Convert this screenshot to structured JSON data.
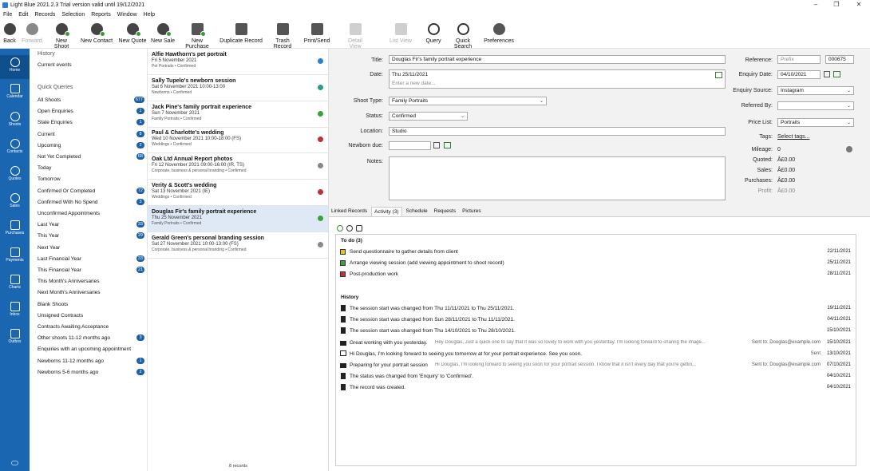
{
  "titlebar": {
    "title": "Light Blue 2021.2.3    Trial version valid until 19/12/2021"
  },
  "menu": [
    "File",
    "Edit",
    "Records",
    "Selection",
    "Reports",
    "Window",
    "Help"
  ],
  "toolbar": {
    "back": "Back",
    "forward": "Forward",
    "new_shoot": "New Shoot",
    "new_contact": "New Contact",
    "new_quote": "New Quote",
    "new_sale": "New Sale",
    "new_purchase": "New Purchase",
    "duplicate": "Duplicate Record",
    "trash": "Trash Record",
    "print": "Print/Send",
    "detail_view": "Detail View",
    "list_view": "List View",
    "query": "Query",
    "quick_search": "Quick Search",
    "preferences": "Preferences"
  },
  "sidebar": {
    "home": "Home",
    "calendar": "Calendar",
    "shoots": "Shoots",
    "contacts": "Contacts",
    "quotes": "Quotes",
    "sales": "Sales",
    "purchases": "Purchases",
    "payments": "Payments",
    "charts": "Charts",
    "inbox": "Inbox",
    "outbox": "Outbox"
  },
  "queries": {
    "history_label": "History",
    "current_events": "Current events",
    "quick_label": "Quick Queries",
    "items": [
      {
        "label": "All Shoots",
        "count": "677"
      },
      {
        "label": "Open Enquiries",
        "count": "1"
      },
      {
        "label": "Stale Enquiries",
        "count": "1"
      },
      {
        "label": "Current",
        "count": "8"
      },
      {
        "label": "Upcoming",
        "count": "2"
      },
      {
        "label": "Not Yet Completed",
        "count": "68"
      },
      {
        "label": "Today",
        "count": ""
      },
      {
        "label": "Tomorrow",
        "count": ""
      },
      {
        "label": "Confirmed Or Completed",
        "count": "72"
      },
      {
        "label": "Confirmed With No Spend",
        "count": "3"
      },
      {
        "label": "Unconfirmed Appointments",
        "count": ""
      },
      {
        "label": "Last Year",
        "count": "33"
      },
      {
        "label": "This Year",
        "count": "29"
      },
      {
        "label": "Next Year",
        "count": ""
      },
      {
        "label": "Last Financial Year",
        "count": "33"
      },
      {
        "label": "This Financial Year",
        "count": "21"
      },
      {
        "label": "This Month's Anniversaries",
        "count": ""
      },
      {
        "label": "Next Month's Anniversaries",
        "count": ""
      },
      {
        "label": "Blank Shoots",
        "count": ""
      },
      {
        "label": "Unsigned Contracts",
        "count": ""
      },
      {
        "label": "Contracts Awaiting Acceptance",
        "count": ""
      },
      {
        "label": "Other shoots 11-12 months ago",
        "count": "3"
      },
      {
        "label": "Enquiries with an upcoming appointment",
        "count": ""
      },
      {
        "label": "Newborns 11-12 months ago",
        "count": "1"
      },
      {
        "label": "Newborns 5-6 months ago",
        "count": "2"
      }
    ]
  },
  "records": [
    {
      "title": "Alfie Hawthorn's pet portrait",
      "date": "Fri 5 November 2021",
      "sub": "Pet Portraits  •  Confirmed",
      "color": "#2a7fd4"
    },
    {
      "title": "Sally Tupelo's newborn session",
      "date": "Sat 6 November 2021 10:00-13:00",
      "sub": "Newborns  •  Confirmed",
      "color": "#2a9a8a"
    },
    {
      "title": "Jack Pine's family portrait experience",
      "date": "Sun 7 November 2021",
      "sub": "Family Portraits  •  Confirmed",
      "color": "#3aa040"
    },
    {
      "title": "Paul & Charlotte's wedding",
      "date": "Wed 10 November 2021 10:00-18:00 (FS)",
      "sub": "Weddings  •  Confirmed",
      "color": "#c0303a"
    },
    {
      "title": "Oak Ltd Annual Report photos",
      "date": "Fri 12 November 2021 09:00-16:00 (IR, TS)",
      "sub": "Corporate, business & personal branding  •  Confirmed",
      "color": "#888888"
    },
    {
      "title": "Verity & Scott's wedding",
      "date": "Sat 13 November 2021 (IE)",
      "sub": "Weddings  •  Confirmed",
      "color": "#c0303a"
    },
    {
      "title": "Douglas Fir's family portrait experience",
      "date": "Thu 25 November 2021",
      "sub": "Family Portraits  •  Confirmed",
      "color": "#3aa040"
    },
    {
      "title": "Gerald Green's personal branding session",
      "date": "Sat 27 November 2021 10:00-13:00 (FS)",
      "sub": "Corporate, business & personal branding  •  Confirmed",
      "color": "#888888"
    }
  ],
  "record_count": "8 records",
  "detail": {
    "title_label": "Title:",
    "title_value": "Douglas Fir's family portrait experience",
    "date_label": "Date:",
    "date_value": "Thu 25/11/2021",
    "date_placeholder": "Enter a new date...",
    "shoot_type_label": "Shoot Type:",
    "shoot_type_value": "Family Portraits",
    "status_label": "Status:",
    "status_value": "Confirmed",
    "location_label": "Location:",
    "location_value": "Studio",
    "newborn_label": "Newborn due:",
    "notes_label": "Notes:",
    "reference_label": "Reference:",
    "reference_prefix": "Prefix",
    "reference_value": "000675",
    "enquiry_date_label": "Enquiry Date:",
    "enquiry_date_value": "04/10/2021",
    "enquiry_source_label": "Enquiry Source:",
    "enquiry_source_value": "Instagram",
    "referred_label": "Referred By:",
    "price_list_label": "Price List:",
    "price_list_value": "Portraits",
    "tags_label": "Tags:",
    "tags_value": "Select tags...",
    "mileage_label": "Mileage:",
    "mileage_value": "0",
    "quoted_label": "Quoted:",
    "quoted_value": "Â£0.00",
    "sales_label": "Sales:",
    "sales_value": "Â£0.00",
    "purchases_label": "Purchases:",
    "purchases_value": "Â£0.00",
    "profit_label": "Profit:",
    "profit_value": "Â£0.00"
  },
  "tabs": [
    "Linked Records",
    "Activity (3)",
    "Schedule",
    "Requests",
    "Pictures"
  ],
  "activity": {
    "todo_label": "To do (3)",
    "todos": [
      {
        "text": "Send questionnaire to gather details from client",
        "date": "22/11/2021",
        "color": "#e8c020"
      },
      {
        "text": "Arrange viewing session (add viewing appointment to shoot record)",
        "date": "25/11/2021",
        "color": "#3aa040"
      },
      {
        "text": "Post-production work",
        "date": "28/11/2021",
        "color": "#c0303a"
      }
    ],
    "history_label": "History",
    "history": [
      {
        "kind": "doc",
        "text": "The session start was changed from Thu 11/11/2021 to Thu 25/11/2021.",
        "preview": "",
        "sent": "",
        "date": "19/11/2021"
      },
      {
        "kind": "doc",
        "text": "The session start was changed from Sun 28/11/2021 to Thu 11/11/2021.",
        "preview": "",
        "sent": "",
        "date": "04/11/2021"
      },
      {
        "kind": "doc",
        "text": "The session start was changed from Thu 14/10/2021 to Thu 28/10/2021.",
        "preview": "",
        "sent": "",
        "date": "15/10/2021"
      },
      {
        "kind": "mail",
        "text": "Great working with you yesterday.",
        "preview": "Hey Douglas,     Just a quick one to say that it was so lovely to work with you yesterday. I'm looking forward to sharing the image...",
        "sent": "Sent to: Douglas@example.com",
        "date": "15/10/2021"
      },
      {
        "kind": "chat",
        "text": "Hi Douglas, I'm looking forward to seeing you tomorrow at for your portrait experience. See you soon.",
        "preview": "",
        "sent": "Sent",
        "date": "13/10/2021"
      },
      {
        "kind": "mail",
        "text": "Preparing for your portrait session",
        "preview": "Hi Douglas,     I'm looking forward to seeing you soon for your portrait session.     I know that it isn't every day that you're gettin...",
        "sent": "Sent to: Douglas@example.com",
        "date": "07/10/2021"
      },
      {
        "kind": "doc",
        "text": "The status was changed from 'Enquiry' to 'Confirmed'.",
        "preview": "",
        "sent": "",
        "date": "04/10/2021"
      },
      {
        "kind": "doc",
        "text": "The record was created.",
        "preview": "",
        "sent": "",
        "date": "04/10/2021"
      }
    ]
  }
}
